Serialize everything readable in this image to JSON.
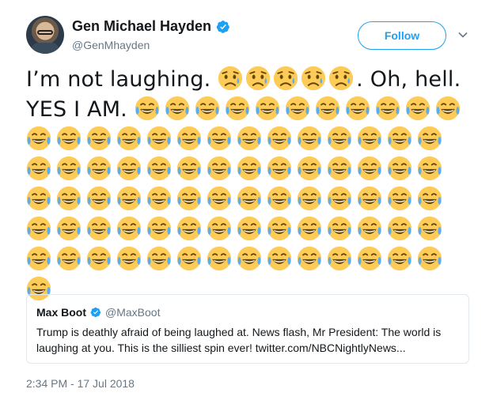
{
  "author": {
    "display_name": "Gen Michael Hayden",
    "handle": "@GenMhayden",
    "verified": true
  },
  "follow_label": "Follow",
  "tweet": {
    "text_lead": "I’m not laughing.",
    "sad_emoji_count": 5,
    "text_middle": ". Oh, hell.",
    "text_yes": "YES I AM.",
    "laugh_emoji_first_line": 11,
    "laugh_emoji_rows": [
      14,
      14,
      14,
      14,
      14,
      1
    ],
    "emoji_names": {
      "sad": "sad-but-relieved-face-emoji",
      "laugh": "face-with-tears-of-joy-emoji"
    }
  },
  "quoted_tweet": {
    "display_name": "Max Boot",
    "handle": "@MaxBoot",
    "verified": true,
    "text": "Trump is deathly afraid of being laughed at. News flash, Mr President: The world is laughing at you. This is the silliest spin ever! twitter.com/NBCNightlyNews..."
  },
  "timestamp": "2:34 PM - 17 Jul 2018",
  "colors": {
    "accent": "#1da1f2",
    "text": "#14171a",
    "muted": "#657786",
    "border": "#e1e8ed",
    "emoji_face": "#fdcb58",
    "emoji_tear": "#5dadec"
  }
}
